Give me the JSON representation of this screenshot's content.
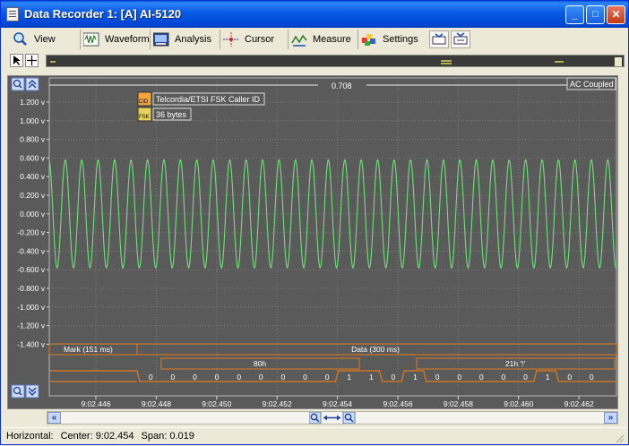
{
  "window": {
    "title": "Data Recorder 1:  [A] AI-5120",
    "controls": {
      "minimize": "_",
      "maximize": "□",
      "close": "✕"
    }
  },
  "toolbar": {
    "buttons": [
      {
        "label": "View",
        "icon": "magnifier-icon"
      },
      {
        "label": "Waveform",
        "icon": "waveform-icon"
      },
      {
        "label": "Analysis",
        "icon": "analysis-icon"
      },
      {
        "label": "Cursor",
        "icon": "cursor-icon"
      },
      {
        "label": "Measure",
        "icon": "measure-icon"
      },
      {
        "label": "Settings",
        "icon": "settings-icon"
      }
    ]
  },
  "plot": {
    "cursor_value": "0.708",
    "coupling": "AC Coupled",
    "decoder_label": "Telcordia/ETSI FSK Caller ID",
    "byte_count": "36 bytes",
    "cid_icon": "CID",
    "fsk_icon": "FSK",
    "y_ticks": [
      "1.200 v",
      "1.000 v",
      "0.800 v",
      "0.600 v",
      "0.400 v",
      "0.200 v",
      "0.000 v",
      "-0.200 v",
      "-0.400 v",
      "-0.600 v",
      "-0.800 v",
      "-1.000 v",
      "-1.200 v",
      "-1.400 v"
    ],
    "x_ticks": [
      "9:02.446",
      "9:02.448",
      "9:02.450",
      "9:02.452",
      "9:02.454",
      "9:02.456",
      "9:02.458",
      "9:02.460",
      "9:02.462"
    ],
    "mark_label": "Mark  (151 ms)",
    "data_label": "Data  (300 ms)",
    "byte1_label": "80h",
    "byte2_label": "21h '!'",
    "bits": [
      "0",
      "0",
      "0",
      "0",
      "0",
      "0",
      "0",
      "0",
      "0",
      "1",
      "1",
      "0",
      "1",
      "0",
      "0",
      "0",
      "0",
      "0",
      "1",
      "0",
      "0"
    ],
    "trace_color": "#6fe07a",
    "decode_color": "#e07a1c",
    "amplitude_volts": 0.58,
    "cycles_visible": 34.5
  },
  "statusbar": {
    "horizontal_label": "Horizontal:",
    "center": "Center: 9:02.454",
    "span": "Span: 0.019"
  }
}
